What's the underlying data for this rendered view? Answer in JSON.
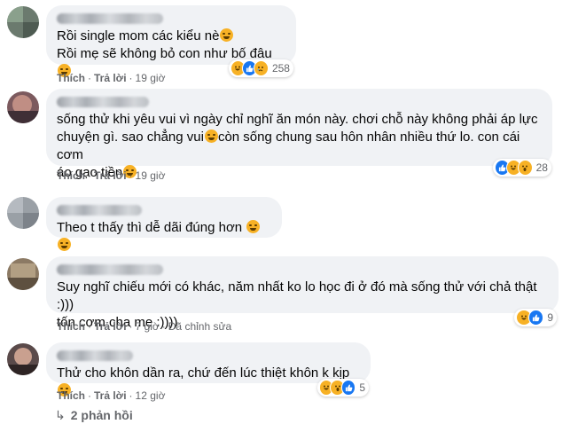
{
  "comments": [
    {
      "lines": [
        "Rồi single mom các kiểu nè",
        "Rồi mẹ sẽ không bỏ con như bố đâu"
      ],
      "line_emojis": [
        "haha-emoji",
        "haha-emoji"
      ],
      "like": "Thích",
      "reply": "Trả lời",
      "time": "19 giờ",
      "edited": "",
      "reactions": [
        "haha",
        "like",
        "sad"
      ],
      "reaction_count": "258"
    },
    {
      "lines": [
        "sống thử khi yêu vui vì ngày chỉ nghĩ ăn món này. chơi chỗ này không phải áp lực",
        "chuyện gì. sao chẳng vui",
        "áo gạo tiền"
      ],
      "inline_after": "còn sống chung sau hôn nhân nhiều thứ lo. con cái cơm",
      "line_emojis": [
        "",
        "rofl-emoji",
        "grimace-emoji"
      ],
      "like": "Thích",
      "reply": "Trả lời",
      "time": "19 giờ",
      "edited": "",
      "reactions": [
        "like",
        "haha",
        "wow"
      ],
      "reaction_count": "28"
    },
    {
      "lines": [
        "Theo t thấy thì dễ dãi đúng hơn"
      ],
      "line_emojis": [
        "tired-emoji"
      ],
      "like": "",
      "reply": "",
      "time": "",
      "edited": "",
      "reactions": [],
      "reaction_count": ""
    },
    {
      "lines": [
        "Suy nghĩ chiếu mới có khác, năm nhất ko lo học đi ở đó mà sống thử với chả thật :)))",
        "tốn cơm cha mẹ :))))"
      ],
      "line_emojis": [
        "",
        ""
      ],
      "like": "Thích",
      "reply": "Trả lời",
      "time": "7 giờ",
      "edited": "Đã chỉnh sửa",
      "reactions": [
        "haha",
        "like"
      ],
      "reaction_count": "9"
    },
    {
      "lines": [
        "Thử cho khôn dần ra, chứ đến lúc thiệt khôn k kịp"
      ],
      "line_emojis": [
        "thinking-emoji"
      ],
      "like": "Thích",
      "reply": "Trả lời",
      "time": "12 giờ",
      "edited": "",
      "reactions": [
        "haha",
        "wow",
        "like"
      ],
      "reaction_count": "5"
    }
  ],
  "replies_link": "2 phản hồi",
  "colors": {
    "bubble": "#f0f2f5",
    "meta": "#65676b",
    "like_blue": "#1877f2",
    "emoji_yellow": "#f7b125"
  }
}
